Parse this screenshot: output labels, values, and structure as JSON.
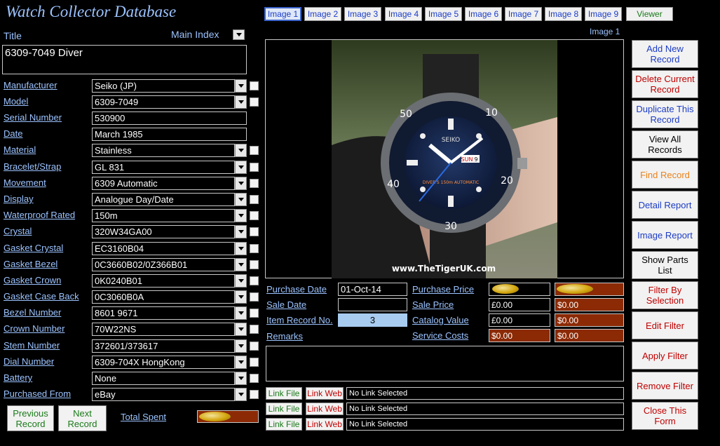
{
  "app": {
    "title": "Watch Collector Database"
  },
  "header": {
    "title_label": "Title",
    "main_index_label": "Main Index",
    "title_value": "6309-7049 Diver"
  },
  "fields": [
    {
      "label": "Manufacturer",
      "value": "Seiko (JP)",
      "type": "combo",
      "check": true
    },
    {
      "label": "Model",
      "value": "6309-7049",
      "type": "combo",
      "check": true
    },
    {
      "label": "Serial Number",
      "value": "530900",
      "type": "text",
      "check": false
    },
    {
      "label": "Date",
      "value": "March 1985",
      "type": "text",
      "check": false
    },
    {
      "label": "Material",
      "value": "Stainless",
      "type": "combo",
      "check": true
    },
    {
      "label": "Bracelet/Strap",
      "value": "GL 831",
      "type": "combo",
      "check": true
    },
    {
      "label": "Movement",
      "value": "6309 Automatic",
      "type": "combo",
      "check": true
    },
    {
      "label": "Display",
      "value": "Analogue Day/Date",
      "type": "combo",
      "check": true
    },
    {
      "label": "Waterproof Rated",
      "value": "150m",
      "type": "combo",
      "check": true
    },
    {
      "label": "Crystal",
      "value": "320W34GA00",
      "type": "combo",
      "check": true
    },
    {
      "label": "Gasket Crystal",
      "value": "EC3160B04",
      "type": "combo",
      "check": true
    },
    {
      "label": "Gasket Bezel",
      "value": "0C3660B02/0Z366B01",
      "type": "combo",
      "check": true
    },
    {
      "label": "Gasket Crown",
      "value": "0K0240B01",
      "type": "combo",
      "check": true
    },
    {
      "label": "Gasket Case Back",
      "value": "0C3060B0A",
      "type": "combo",
      "check": true
    },
    {
      "label": "Bezel Number",
      "value": "8601 9671",
      "type": "combo",
      "check": true
    },
    {
      "label": "Crown Number",
      "value": "70W22NS",
      "type": "combo",
      "check": true
    },
    {
      "label": "Stem Number",
      "value": "372601/373617",
      "type": "combo",
      "check": true
    },
    {
      "label": "Dial Number",
      "value": "6309-704X HongKong",
      "type": "combo",
      "check": true
    },
    {
      "label": "Battery",
      "value": "None",
      "type": "combo",
      "check": true
    },
    {
      "label": "Purchased From",
      "value": "eBay",
      "type": "combo",
      "check": true
    }
  ],
  "nav": {
    "previous": "Previous Record",
    "next": "Next Record",
    "total_spent_label": "Total Spent"
  },
  "image_tabs": [
    "Image 1",
    "Image 2",
    "Image 3",
    "Image 4",
    "Image 5",
    "Image 6",
    "Image 7",
    "Image 8",
    "Image 9"
  ],
  "viewer_label": "Viewer",
  "image_caption": "Image 1",
  "watermark": "www.TheTigerUK.com",
  "dial_numbers": [
    "50",
    "10",
    "20",
    "40",
    "30"
  ],
  "dial_brand": "SEIKO",
  "dial_day": "SUN",
  "dial_date": "9",
  "dial_text": "DIVER'S 150m AUTOMATIC",
  "details": {
    "purchase_date_label": "Purchase Date",
    "purchase_date": "01-Oct-14",
    "purchase_price_label": "Purchase Price",
    "sale_date_label": "Sale Date",
    "sale_date": "",
    "sale_price_label": "Sale Price",
    "sale_price": "£0.00",
    "sale_price_usd": "$0.00",
    "item_record_label": "Item Record No.",
    "item_record": "3",
    "catalog_value_label": "Catalog Value",
    "catalog_value": "£0.00",
    "catalog_value_usd": "$0.00",
    "remarks_label": "Remarks",
    "service_costs_label": "Service Costs",
    "service_costs": "$0.00",
    "service_costs_2": "$0.00"
  },
  "links": [
    {
      "file": "Link File",
      "web": "Link Web",
      "value": "No Link Selected"
    },
    {
      "file": "Link File",
      "web": "Link Web",
      "value": "No Link Selected"
    },
    {
      "file": "Link File",
      "web": "Link Web",
      "value": "No Link Selected"
    }
  ],
  "actions": [
    {
      "label": "Add New Record",
      "color": "blue"
    },
    {
      "label": "Delete Current Record",
      "color": "red"
    },
    {
      "label": "Duplicate This Record",
      "color": "blue"
    },
    {
      "label": "View All Records",
      "color": "black"
    },
    {
      "label": "Find Record",
      "color": "orange"
    },
    {
      "label": "Detail Report",
      "color": "blue"
    },
    {
      "label": "Image Report",
      "color": "blue"
    },
    {
      "label": "Show Parts List",
      "color": "black"
    },
    {
      "label": "Filter By Selection",
      "color": "red"
    },
    {
      "label": "Edit Filter",
      "color": "red"
    },
    {
      "label": "Apply Filter",
      "color": "red"
    },
    {
      "label": "Remove Filter",
      "color": "red"
    },
    {
      "label": "Close This Form",
      "color": "red"
    }
  ],
  "colors": {
    "label_blue": "#9cc3ff",
    "orange_field": "#8b2a05",
    "accent_gold": "#d4a70f"
  }
}
